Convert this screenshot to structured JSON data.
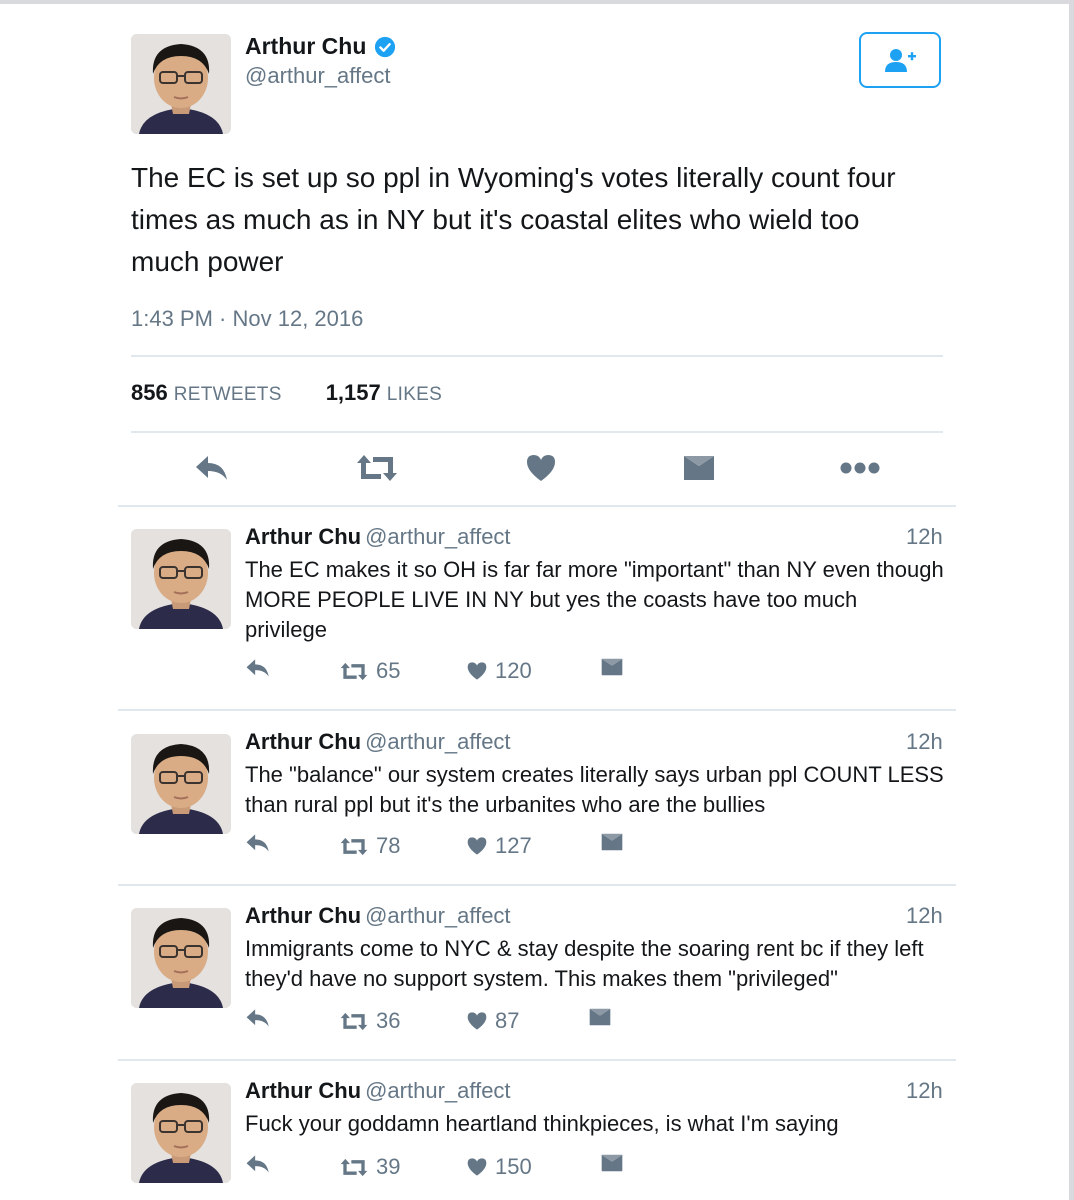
{
  "main_tweet": {
    "name": "Arthur Chu",
    "handle": "@arthur_affect",
    "text": "The EC is set up so ppl in Wyoming's votes literally count four times as much as in NY but it's coastal elites who wield too much power",
    "timestamp": "1:43 PM · Nov 12, 2016",
    "retweets_count": "856",
    "retweets_label": "RETWEETS",
    "likes_count": "1,157",
    "likes_label": "LIKES",
    "icons": [
      "reply-icon",
      "retweet-icon",
      "like-icon",
      "direct-message-icon",
      "more-icon"
    ]
  },
  "replies": [
    {
      "name": "Arthur Chu",
      "handle": "@arthur_affect",
      "time": "12h",
      "text": "The EC makes it so OH is far far more \"important\" than NY even though MORE PEOPLE LIVE IN NY but yes the coasts have too much privilege",
      "retweets": "65",
      "likes": "120"
    },
    {
      "name": "Arthur Chu",
      "handle": "@arthur_affect",
      "time": "12h",
      "text": "The \"balance\" our system creates literally says urban ppl COUNT LESS than rural ppl but it's the urbanites who are the bullies",
      "retweets": "78",
      "likes": "127"
    },
    {
      "name": "Arthur Chu",
      "handle": "@arthur_affect",
      "time": "12h",
      "text": "Immigrants come to NYC & stay despite the soaring rent bc if they left they'd have no support system. This makes them \"privileged\"",
      "retweets": "36",
      "likes": "87"
    },
    {
      "name": "Arthur Chu",
      "handle": "@arthur_affect",
      "time": "12h",
      "text": "Fuck your goddamn heartland thinkpieces, is what I'm saying",
      "retweets": "39",
      "likes": "150"
    }
  ],
  "colors": {
    "accent": "#1da1f2",
    "text": "#14171a",
    "secondary": "#657786",
    "icon": "#657786",
    "divider": "#e1e8ed"
  }
}
